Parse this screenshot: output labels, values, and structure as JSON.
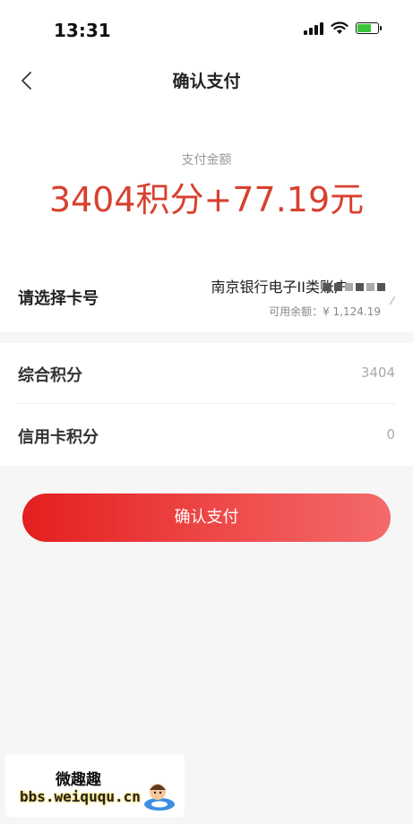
{
  "status_bar": {
    "time": "13:31"
  },
  "nav": {
    "title": "确认支付"
  },
  "payment": {
    "amount_label": "支付金额",
    "amount": "3404积分+77.19元",
    "accent_color": "#d8402f"
  },
  "card": {
    "label": "请选择卡号",
    "name": "南京银行电子II类账户",
    "balance": "可用余额：¥ 1,124.19"
  },
  "points": [
    {
      "label": "综合积分",
      "value": "3404"
    },
    {
      "label": "信用卡积分",
      "value": "0"
    }
  ],
  "confirm_button": {
    "label": "确认支付"
  },
  "watermark": {
    "title": "微趣趣",
    "url": "bbs.weiququ.cn"
  }
}
